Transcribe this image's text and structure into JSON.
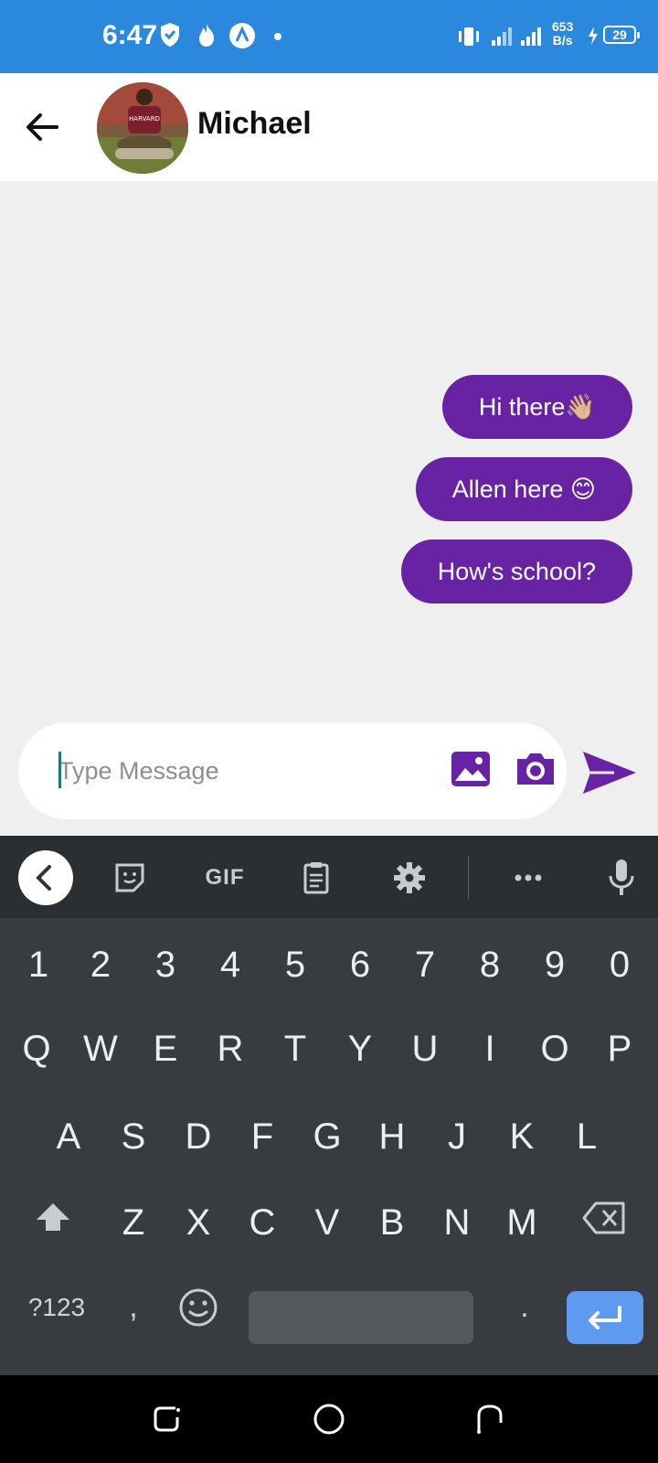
{
  "status_bar": {
    "time": "6:47",
    "net_speed_value": "653",
    "net_speed_unit": "B/s",
    "battery": "29",
    "background": "#2a89dc"
  },
  "header": {
    "contact_name": "Michael",
    "avatar_shirt_text": "HARVARD"
  },
  "messages": [
    {
      "text": "Hi there👋🏼",
      "sender": "me"
    },
    {
      "text": "Allen here 😊",
      "sender": "me"
    },
    {
      "text": "How's school?",
      "sender": "me"
    }
  ],
  "composer": {
    "placeholder": "Type Message",
    "value": ""
  },
  "keyboard": {
    "toolbar": {
      "gif_label": "GIF"
    },
    "number_row": [
      "1",
      "2",
      "3",
      "4",
      "5",
      "6",
      "7",
      "8",
      "9",
      "0"
    ],
    "row1": [
      "Q",
      "W",
      "E",
      "R",
      "T",
      "Y",
      "U",
      "I",
      "O",
      "P"
    ],
    "row2": [
      "A",
      "S",
      "D",
      "F",
      "G",
      "H",
      "J",
      "K",
      "L"
    ],
    "row3": [
      "Z",
      "X",
      "C",
      "V",
      "B",
      "N",
      "M"
    ],
    "symbols_label": "?123",
    "comma": ",",
    "period": "."
  },
  "colors": {
    "accent": "#6723a3",
    "keyboard_bg": "#383c40",
    "enter_key": "#5e9af0"
  },
  "icons": [
    "shield-icon",
    "fire-icon",
    "app-a-icon",
    "vibrate-icon",
    "signal-icon",
    "charging-icon",
    "back-arrow-icon",
    "gallery-icon",
    "camera-icon",
    "send-icon",
    "sticker-icon",
    "clipboard-icon",
    "settings-icon",
    "more-icon",
    "mic-icon",
    "shift-icon",
    "backspace-icon",
    "emoji-icon",
    "enter-icon",
    "recents-icon",
    "home-icon",
    "nav-back-icon"
  ]
}
